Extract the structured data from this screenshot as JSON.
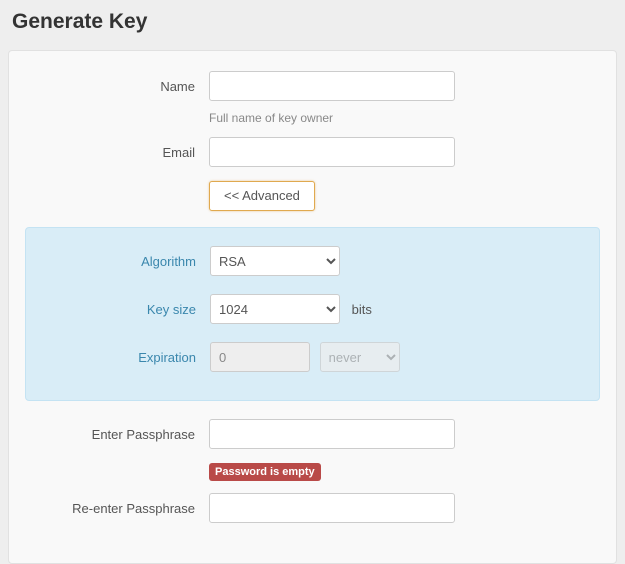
{
  "title": "Generate Key",
  "form": {
    "name": {
      "label": "Name",
      "value": "",
      "help": "Full name of key owner"
    },
    "email": {
      "label": "Email",
      "value": ""
    },
    "advanced_button": "<< Advanced",
    "algorithm": {
      "label": "Algorithm",
      "selected": "RSA"
    },
    "key_size": {
      "label": "Key size",
      "selected": "1024",
      "unit": "bits"
    },
    "expiration": {
      "label": "Expiration",
      "value": "0",
      "unit_selected": "never"
    },
    "passphrase": {
      "label": "Enter Passphrase",
      "value": "",
      "error": "Password is empty"
    },
    "passphrase_confirm": {
      "label": "Re-enter Passphrase",
      "value": ""
    }
  },
  "colors": {
    "advanced_bg": "#d9edf7",
    "error_bg": "#b94a48"
  }
}
